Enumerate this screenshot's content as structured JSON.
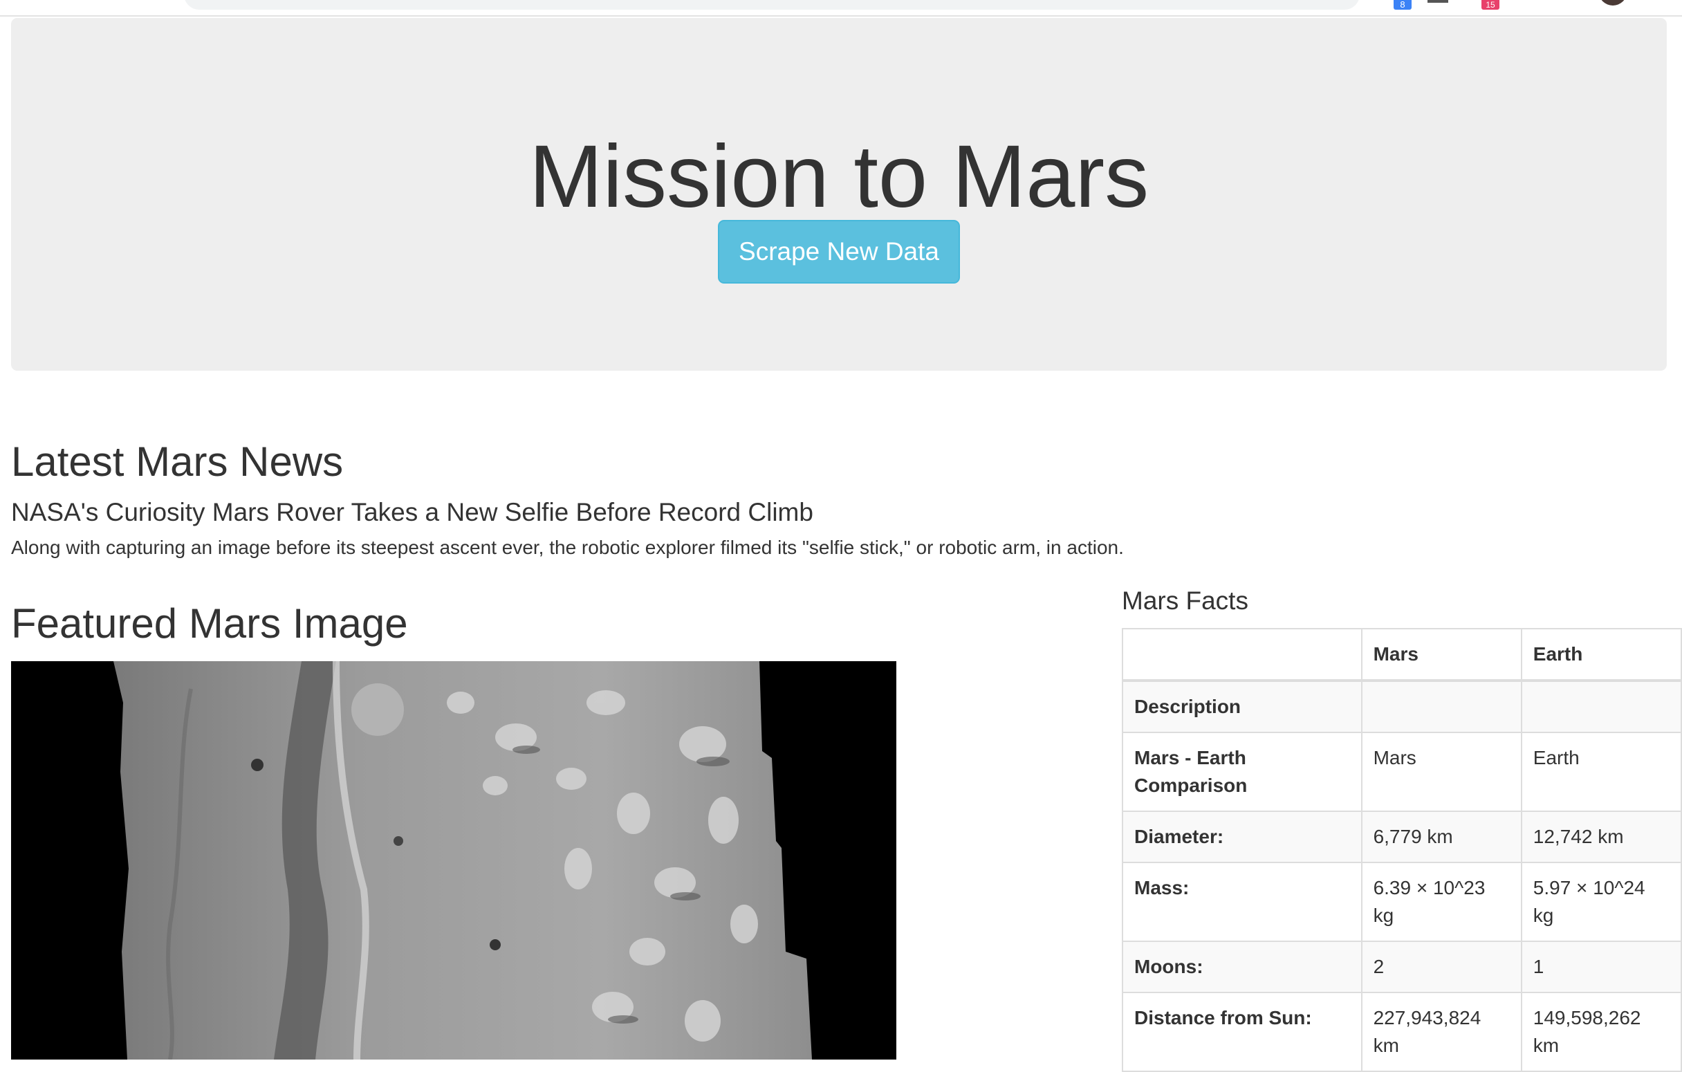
{
  "browser": {
    "extension_badge_blue": "8",
    "extension_badge_red": "15"
  },
  "jumbotron": {
    "title": "Mission to Mars",
    "scrape_button_label": "Scrape New Data"
  },
  "news": {
    "heading": "Latest Mars News",
    "title": "NASA's Curiosity Mars Rover Takes a New Selfie Before Record Climb",
    "paragraph": "Along with capturing an image before its steepest ascent ever, the robotic explorer filmed its \"selfie stick,\" or robotic arm, in action."
  },
  "featured_image": {
    "heading": "Featured Mars Image"
  },
  "facts": {
    "heading": "Mars Facts",
    "columns": [
      "",
      "Mars",
      "Earth"
    ],
    "rows": [
      {
        "label": "Description",
        "mars": "",
        "earth": ""
      },
      {
        "label": "Mars - Earth Comparison",
        "mars": "Mars",
        "earth": "Earth"
      },
      {
        "label": "Diameter:",
        "mars": "6,779 km",
        "earth": "12,742 km"
      },
      {
        "label": "Mass:",
        "mars": "6.39 × 10^23 kg",
        "earth": "5.97 × 10^24 kg"
      },
      {
        "label": "Moons:",
        "mars": "2",
        "earth": "1"
      },
      {
        "label": "Distance from Sun:",
        "mars": "227,943,824 km",
        "earth": "149,598,262 km"
      }
    ]
  },
  "colors": {
    "jumbotron_bg": "#eeeeee",
    "button_info": "#5bc0de",
    "text": "#333333"
  }
}
